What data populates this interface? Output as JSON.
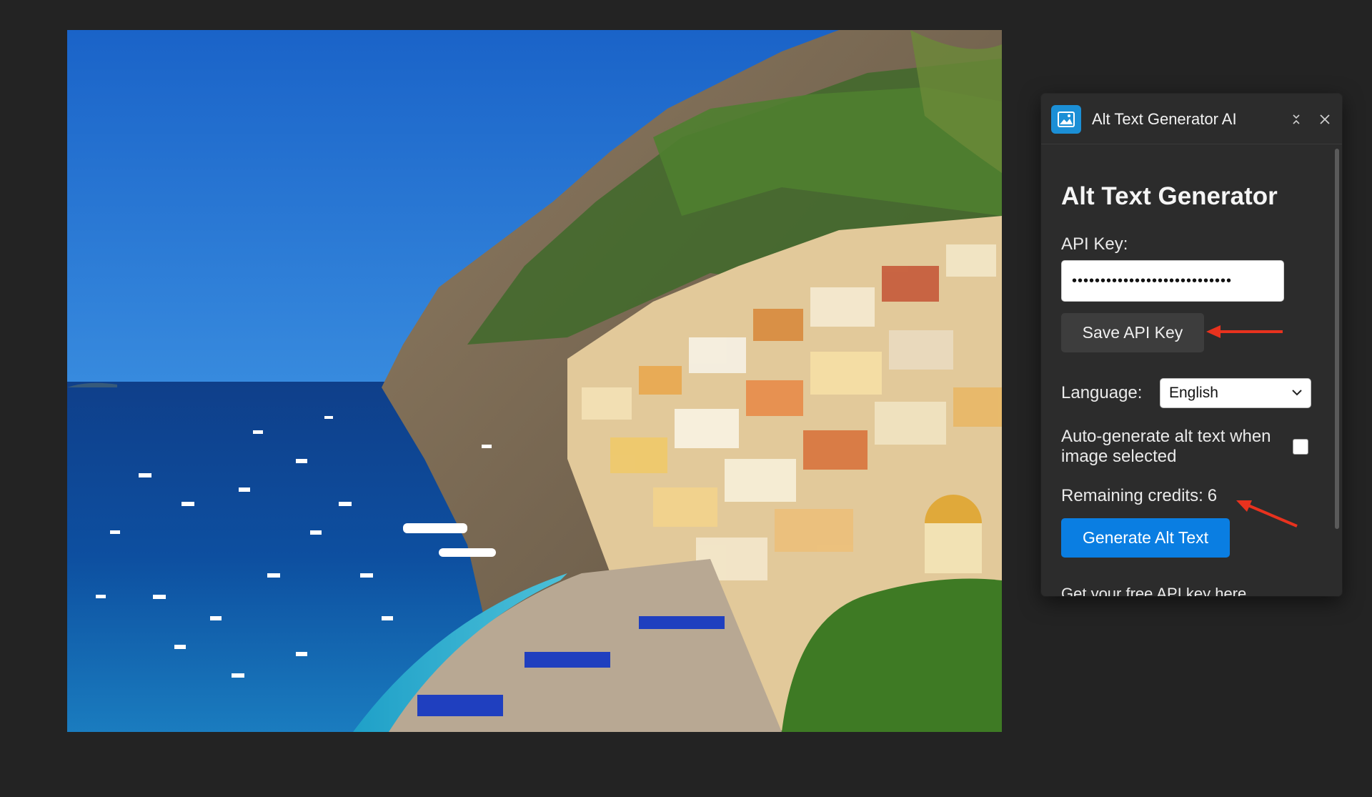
{
  "panel": {
    "icon": "image-icon",
    "title": "Alt Text Generator AI",
    "collapse_icon": "collapse-arrows-icon",
    "close_icon": "close-icon"
  },
  "form": {
    "heading": "Alt Text Generator",
    "api_key_label": "API Key:",
    "api_key_value": "••••••••••••••••••••••••••••",
    "save_button": "Save API Key",
    "language_label": "Language:",
    "language_selected": "English",
    "auto_generate_label": "Auto-generate alt text when image selected",
    "auto_generate_checked": false,
    "credits_label": "Remaining credits:",
    "credits_value": "6",
    "generate_button": "Generate Alt Text",
    "api_link_text": "Get your free API key here"
  },
  "colors": {
    "background": "#232323",
    "panel": "#2c2c2c",
    "primary_button": "#0a7ee2",
    "secondary_button": "#3d3d3d",
    "annotation_arrow": "#e8321e"
  }
}
